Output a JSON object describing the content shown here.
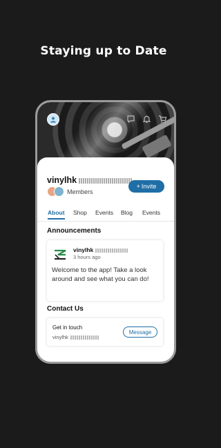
{
  "headline": "Staying up to Date",
  "site": {
    "name": "vinylhk",
    "invite_label": "Invite",
    "members_label": "Members"
  },
  "tabs": [
    {
      "label": "About",
      "active": true
    },
    {
      "label": "Shop",
      "active": false
    },
    {
      "label": "Events",
      "active": false
    },
    {
      "label": "Blog",
      "active": false
    },
    {
      "label": "Events",
      "active": false
    }
  ],
  "announcements": {
    "title": "Announcements",
    "post": {
      "author": "vinylhk",
      "time": "3 hours ago",
      "text": "Welcome to the app! Take a look around and see what you can do!"
    }
  },
  "contact": {
    "title": "Contact Us",
    "card_title": "Get in touch",
    "card_sub": "vinylhk",
    "message_label": "Message"
  },
  "colors": {
    "accent": "#1f6ea6",
    "background": "#1b1b1b"
  },
  "icons": [
    "profile-icon",
    "chat-icon",
    "bell-icon",
    "cart-icon",
    "plus-icon"
  ]
}
